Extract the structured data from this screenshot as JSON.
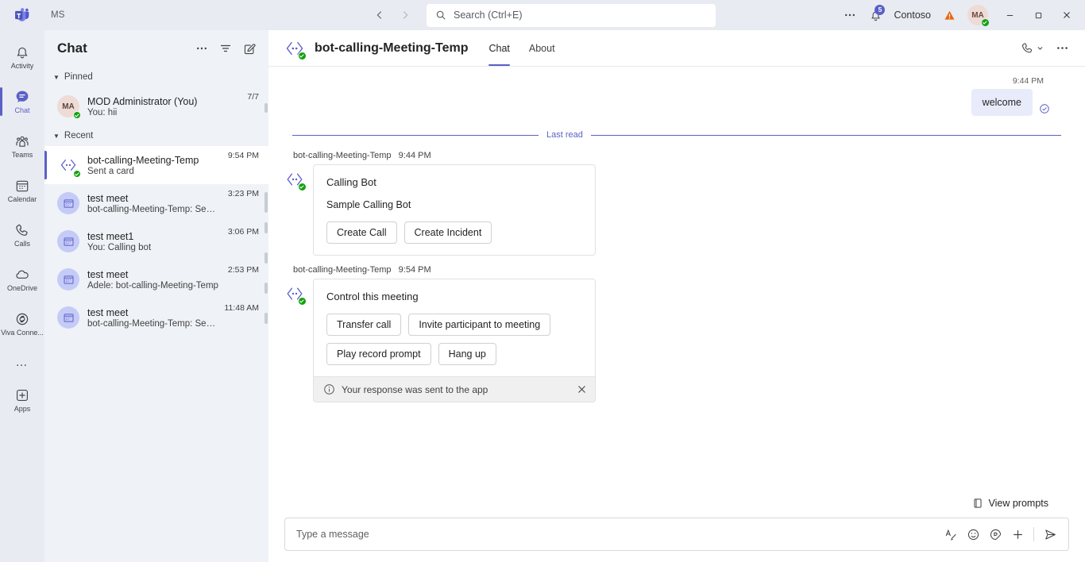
{
  "titlebar": {
    "org_initials": "MS",
    "nav_back": "back-arrow",
    "nav_forward": "forward-arrow",
    "search_placeholder": "Search (Ctrl+E)",
    "more_label": "…",
    "notifications_badge": "5",
    "tenant": "Contoso",
    "avatar_initials": "MA",
    "minimize": "–",
    "maximize": "❐",
    "close": "✕"
  },
  "rail": {
    "items": [
      {
        "label": "Activity",
        "icon": "bell-icon",
        "active": false
      },
      {
        "label": "Chat",
        "icon": "chat-icon",
        "active": true
      },
      {
        "label": "Teams",
        "icon": "teams-icon",
        "active": false
      },
      {
        "label": "Calendar",
        "icon": "calendar-icon",
        "active": false
      },
      {
        "label": "Calls",
        "icon": "phone-icon",
        "active": false
      },
      {
        "label": "OneDrive",
        "icon": "cloud-icon",
        "active": false
      },
      {
        "label": "Viva Conne...",
        "icon": "viva-icon",
        "active": false
      }
    ],
    "more": "…",
    "apps_label": "Apps"
  },
  "chatlist": {
    "title": "Chat",
    "actions": {
      "more": "more-options",
      "filter": "filter",
      "compose": "new-chat"
    },
    "groups": [
      {
        "name": "Pinned",
        "rows": [
          {
            "avatar_type": "person",
            "initials": "MA",
            "name": "MOD Administrator (You)",
            "preview": "You: hii",
            "time": "7/7",
            "selected": false,
            "presence": true
          }
        ]
      },
      {
        "name": "Recent",
        "rows": [
          {
            "avatar_type": "bot",
            "initials": "",
            "name": "bot-calling-Meeting-Temp",
            "preview": "Sent a card",
            "time": "9:54 PM",
            "selected": true,
            "presence": true
          },
          {
            "avatar_type": "meet",
            "initials": "",
            "name": "test meet",
            "preview": "bot-calling-Meeting-Temp: Sent a card",
            "time": "3:23 PM",
            "selected": false,
            "presence": false
          },
          {
            "avatar_type": "meet",
            "initials": "",
            "name": "test meet1",
            "preview": "You: Calling bot",
            "time": "3:06 PM",
            "selected": false,
            "presence": false
          },
          {
            "avatar_type": "meet",
            "initials": "",
            "name": "test meet",
            "preview": "Adele: bot-calling-Meeting-Temp",
            "time": "2:53 PM",
            "selected": false,
            "presence": false
          },
          {
            "avatar_type": "meet",
            "initials": "",
            "name": "test meet",
            "preview": "bot-calling-Meeting-Temp: Sent a card",
            "time": "11:48 AM",
            "selected": false,
            "presence": false
          }
        ]
      }
    ]
  },
  "main": {
    "title": "bot-calling-Meeting-Temp",
    "tabs": [
      {
        "label": "Chat",
        "active": true
      },
      {
        "label": "About",
        "active": false
      }
    ],
    "header_actions": {
      "call": "video-call",
      "more": "more-options"
    },
    "outgoing": {
      "time": "9:44 PM",
      "text": "welcome",
      "read_receipt": "read-check"
    },
    "divider_label": "Last read",
    "messages": [
      {
        "sender": "bot-calling-Meeting-Temp",
        "time": "9:44 PM",
        "card": {
          "title": "Calling Bot",
          "subtitle": "Sample Calling Bot",
          "buttons": [
            "Create Call",
            "Create Incident"
          ],
          "note": null
        }
      },
      {
        "sender": "bot-calling-Meeting-Temp",
        "time": "9:54 PM",
        "card": {
          "title": "Control this meeting",
          "subtitle": null,
          "buttons": [
            "Transfer call",
            "Invite participant to meeting",
            "Play record prompt",
            "Hang up"
          ],
          "note": "Your response was sent to the app"
        }
      }
    ],
    "view_prompts": "View prompts",
    "compose_placeholder": "Type a message",
    "compose_icons": [
      "format-icon",
      "emoji-icon",
      "sticker-icon",
      "plus-icon",
      "send-icon"
    ]
  },
  "colors": {
    "accent": "#5b5fc7",
    "rail_bg": "#e8ebf1",
    "list_bg": "#eff2f7",
    "bubble_bg": "#e8ebfa",
    "presence_green": "#13a10e",
    "warn_orange": "#e8650f"
  }
}
